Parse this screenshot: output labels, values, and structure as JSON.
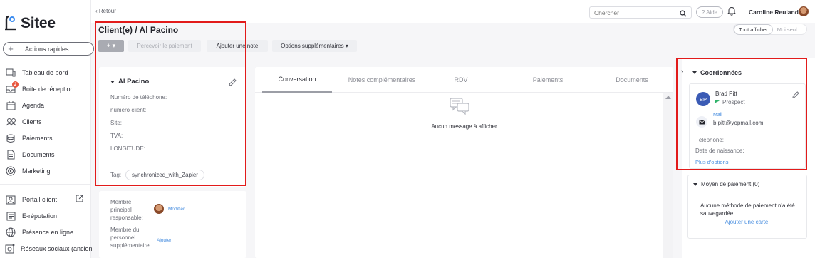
{
  "brand": {
    "name": "Sitee"
  },
  "sidebar": {
    "actions_label": "Actions rapides",
    "items": [
      {
        "label": "Tableau de bord",
        "icon": "dashboard-icon"
      },
      {
        "label": "Boite de réception",
        "icon": "inbox-icon",
        "badge": "2"
      },
      {
        "label": "Agenda",
        "icon": "calendar-icon"
      },
      {
        "label": "Clients",
        "icon": "users-icon"
      },
      {
        "label": "Paiements",
        "icon": "coins-icon"
      },
      {
        "label": "Documents",
        "icon": "document-icon"
      },
      {
        "label": "Marketing",
        "icon": "target-icon"
      },
      {
        "label": "Portail client",
        "icon": "portal-icon"
      },
      {
        "label": "E-réputation",
        "icon": "reputation-icon"
      },
      {
        "label": "Présence en ligne",
        "icon": "globe-icon"
      },
      {
        "label": "Réseaux sociaux (ancien",
        "icon": "social-icon"
      }
    ]
  },
  "topbar": {
    "back_label": "‹ Retour",
    "search_placeholder": "Chercher",
    "help_label": "? Aide",
    "user_name": "Caroline Reuland"
  },
  "view_toggle": {
    "active": "Tout afficher",
    "inactive": "Moi seul"
  },
  "page": {
    "title": "Client(e) / Al Pacino"
  },
  "toolbar": {
    "plus_label": "+ ▾",
    "pay_label": "Percevoir le paiement",
    "note_label": "Ajouter une note",
    "options_label": "Options supplémentaires ▾"
  },
  "contact": {
    "name": "Al Pacino",
    "fields": [
      "Numéro de téléphone:",
      "numéro client:",
      "Site:",
      "TVA:",
      "LONGITUDE:"
    ],
    "tag_label": "Tag:",
    "tag": "synchronized_with_Zapier"
  },
  "members": {
    "principal_label": "Membre principal responsable:",
    "principal_action": "Modifier",
    "extra_label": "Membre du personnel supplémentaire",
    "extra_action": "Ajouter"
  },
  "tabs": [
    "Conversation",
    "Notes complémentaires",
    "RDV",
    "Paiements",
    "Documents"
  ],
  "conversation": {
    "empty": "Aucun message à afficher"
  },
  "coordinates": {
    "title": "Coordonnées",
    "initials": "BP",
    "name": "Brad Pitt",
    "status": "Prospect",
    "mail_label": "Mail",
    "mail_value": "b.pitt@yopmail.com",
    "phone_label": "Téléphone:",
    "birth_label": "Date de naissance:",
    "more_link": "Plus d'options"
  },
  "payment_methods": {
    "title": "Moyen de paiement (0)",
    "empty": "Aucune méthode de paiement n'a été sauvegardée",
    "add_link": "+ Ajouter une carte"
  },
  "colors": {
    "highlight": "#e21b1b",
    "link": "#4a8fe0",
    "avatar_bp": "#3b5bb5",
    "badge": "#e8553d"
  }
}
